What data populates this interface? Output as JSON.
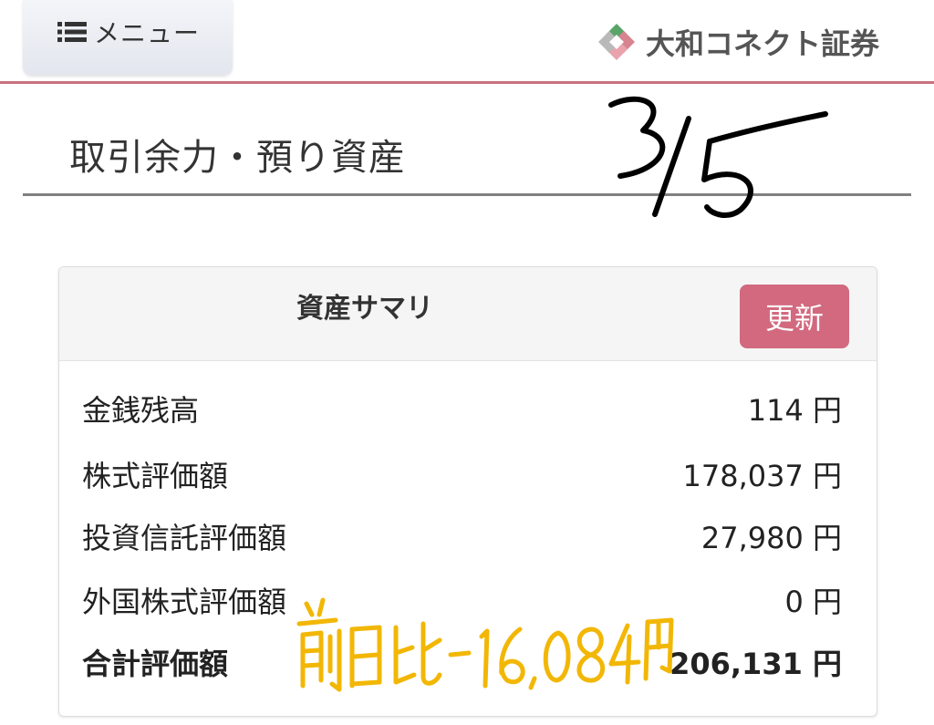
{
  "header": {
    "menu_label": "メニュー",
    "brand_name": "大和コネクト証券",
    "menu_icon": "list-icon",
    "brand_logo": "daiwa-connect-logo",
    "accent_color": "#c9707d"
  },
  "page": {
    "title": "取引余力・預り資産"
  },
  "summary": {
    "title": "資産サマリ",
    "refresh_label": "更新",
    "refresh_color": "#d2697e",
    "rows": [
      {
        "label": "金銭残高",
        "value": "114 円"
      },
      {
        "label": "株式評価額",
        "value": "178,037 円"
      },
      {
        "label": "投資信託評価額",
        "value": "27,980 円"
      },
      {
        "label": "外国株式評価額",
        "value": "0 円"
      },
      {
        "label": "合計評価額",
        "value": "206,131 円"
      }
    ]
  },
  "handwriting": {
    "date": "3/5",
    "note": "前日比 -16,084円"
  }
}
